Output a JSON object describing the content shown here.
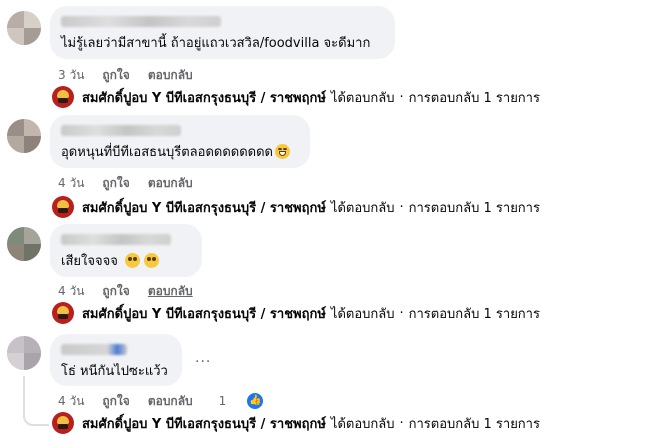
{
  "comments": [
    {
      "text": "ไม่รู้เลยว่ามีสาขานี้ ถ้าอยู่แถวเวสวิล/foodvilla จะดีมาก",
      "time": "3 วัน",
      "like": "ถูกใจ",
      "reply": "ตอบกลับ",
      "emoji": ""
    },
    {
      "text": "อุดหนุนที่บีทีเอสธนบุรีตลอดดดดดดดด",
      "time": "4 วัน",
      "like": "ถูกใจ",
      "reply": "ตอบกลับ",
      "emoji": "grin"
    },
    {
      "text": "เสียใจจจจ",
      "time": "4 วัน",
      "like": "ถูกใจ",
      "reply": "ตอบกลับ",
      "emoji": "pleading-pleading"
    },
    {
      "text": "โธ่ หนีกันไปซะแว้ว",
      "time": "4 วัน",
      "like": "ถูกใจ",
      "reply": "ตอบกลับ",
      "reaction_count": "1",
      "more": "..."
    }
  ],
  "page_reply": {
    "name": "สมศักดิ์ปูอบ Y บีทีเอสกรุงธนบุรี / ราชพฤกษ์",
    "action": "ได้ตอบกลับ",
    "sep": "·",
    "count": "การตอบกลับ 1 รายการ"
  },
  "colors": {
    "bubble": "#f0f2f5",
    "meta": "#65676b",
    "like_blue": "#1877f2",
    "page_logo": "#b8201e"
  }
}
